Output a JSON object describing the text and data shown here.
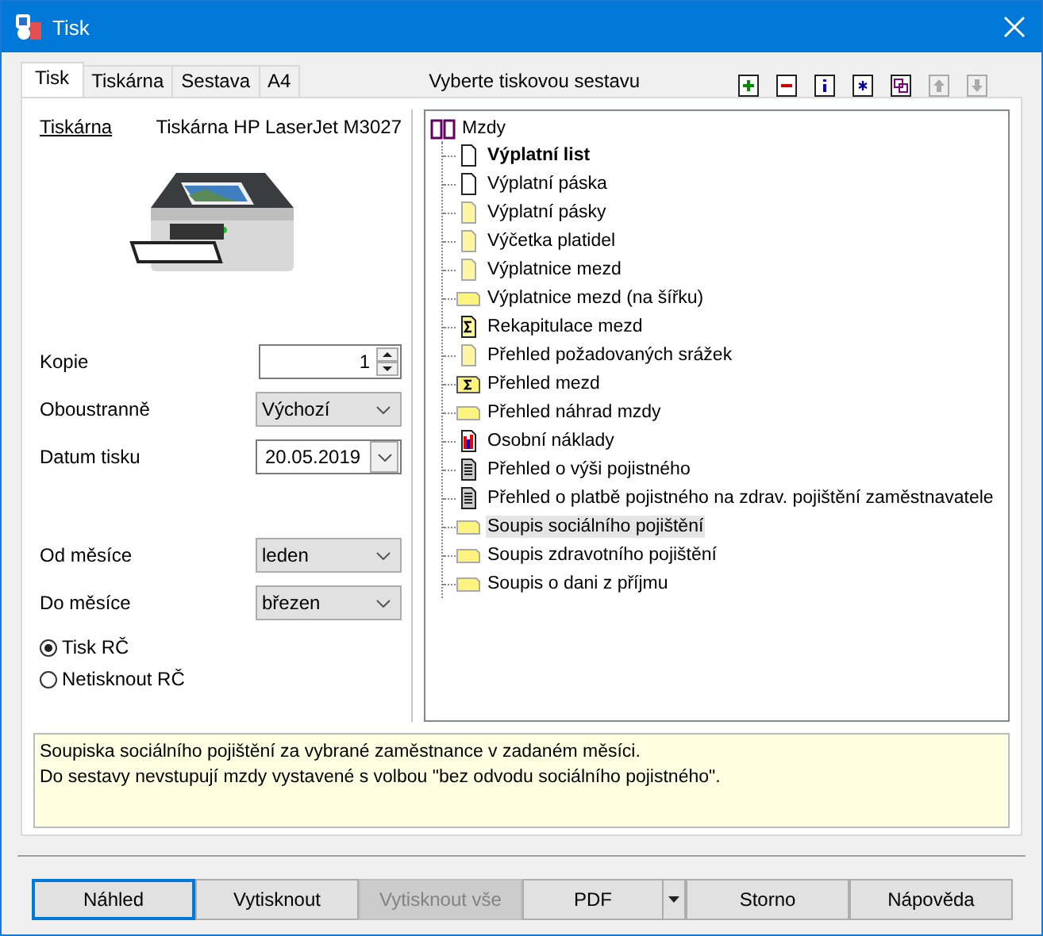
{
  "window": {
    "title": "Tisk"
  },
  "tabs": [
    {
      "label": "Tisk",
      "selected": true
    },
    {
      "label": "Tiskárna",
      "selected": false
    },
    {
      "label": "Sestava",
      "selected": false
    },
    {
      "label": "A4",
      "selected": false
    }
  ],
  "report_heading": "Vyberte tiskovou sestavu",
  "toolbar": [
    {
      "kind": "add",
      "disabled": false
    },
    {
      "kind": "remove",
      "disabled": false
    },
    {
      "kind": "info",
      "disabled": false
    },
    {
      "kind": "star",
      "disabled": false
    },
    {
      "kind": "copy",
      "disabled": false
    },
    {
      "kind": "up",
      "disabled": true
    },
    {
      "kind": "down",
      "disabled": true
    }
  ],
  "printer": {
    "link": "Tiskárna",
    "name": "Tiskárna HP LaserJet M3027"
  },
  "copies": {
    "label": "Kopie",
    "value": "1"
  },
  "duplex": {
    "label": "Oboustranně",
    "value": "Výchozí"
  },
  "print_date": {
    "label": "Datum tisku",
    "value": "20.05.2019"
  },
  "from_month": {
    "label": "Od měsíce",
    "value": "leden"
  },
  "to_month": {
    "label": "Do měsíce",
    "value": "březen"
  },
  "radios": [
    {
      "label": "Tisk RČ",
      "selected": true
    },
    {
      "label": "Netisknout RČ",
      "selected": false
    }
  ],
  "tree": {
    "label": "Mzdy",
    "children": [
      {
        "label": "Výplatní list",
        "kind": "page",
        "bold": true,
        "selected": false
      },
      {
        "label": "Výplatní páska",
        "kind": "page",
        "bold": false,
        "selected": false
      },
      {
        "label": "Výplatní pásky",
        "kind": "form",
        "bold": false,
        "selected": false
      },
      {
        "label": "Výčetka platidel",
        "kind": "form",
        "bold": false,
        "selected": false
      },
      {
        "label": "Výplatnice mezd",
        "kind": "form",
        "bold": false,
        "selected": false
      },
      {
        "label": "Výplatnice mezd (na šířku)",
        "kind": "landscape",
        "bold": false,
        "selected": false
      },
      {
        "label": "Rekapitulace mezd",
        "kind": "sigma",
        "bold": false,
        "selected": false
      },
      {
        "label": "Přehled požadovaných srážek",
        "kind": "form",
        "bold": false,
        "selected": false
      },
      {
        "label": "Přehled mezd",
        "kind": "sigma-landscape",
        "bold": false,
        "selected": false
      },
      {
        "label": "Přehled náhrad mzdy",
        "kind": "landscape",
        "bold": false,
        "selected": false
      },
      {
        "label": "Osobní náklady",
        "kind": "chart",
        "bold": false,
        "selected": false
      },
      {
        "label": "Přehled o výši pojistného",
        "kind": "text",
        "bold": false,
        "selected": false
      },
      {
        "label": "Přehled o platbě pojistného na zdrav. pojištění zaměstnavatele",
        "kind": "text",
        "bold": false,
        "selected": false
      },
      {
        "label": "Soupis sociálního pojištění",
        "kind": "landscape",
        "bold": false,
        "selected": true
      },
      {
        "label": "Soupis zdravotního pojištění",
        "kind": "landscape",
        "bold": false,
        "selected": false
      },
      {
        "label": "Soupis o dani z příjmu",
        "kind": "landscape",
        "bold": false,
        "selected": false
      }
    ]
  },
  "description": [
    "Soupiska sociálního pojištění za vybrané zaměstnance v zadaném měsíci.",
    "Do sestavy nevstupují mzdy vystavené s volbou \"bez odvodu sociálního pojistného\"."
  ],
  "buttons": [
    {
      "label": "Náhled",
      "kind": "default",
      "disabled": false
    },
    {
      "label": "Vytisknout",
      "kind": "plain",
      "disabled": false
    },
    {
      "label": "Vytisknout vše",
      "kind": "plain",
      "disabled": true
    },
    {
      "label": "PDF",
      "kind": "split",
      "disabled": false
    },
    {
      "label": "Storno",
      "kind": "plain",
      "disabled": false
    },
    {
      "label": "Nápověda",
      "kind": "plain",
      "disabled": false
    }
  ]
}
